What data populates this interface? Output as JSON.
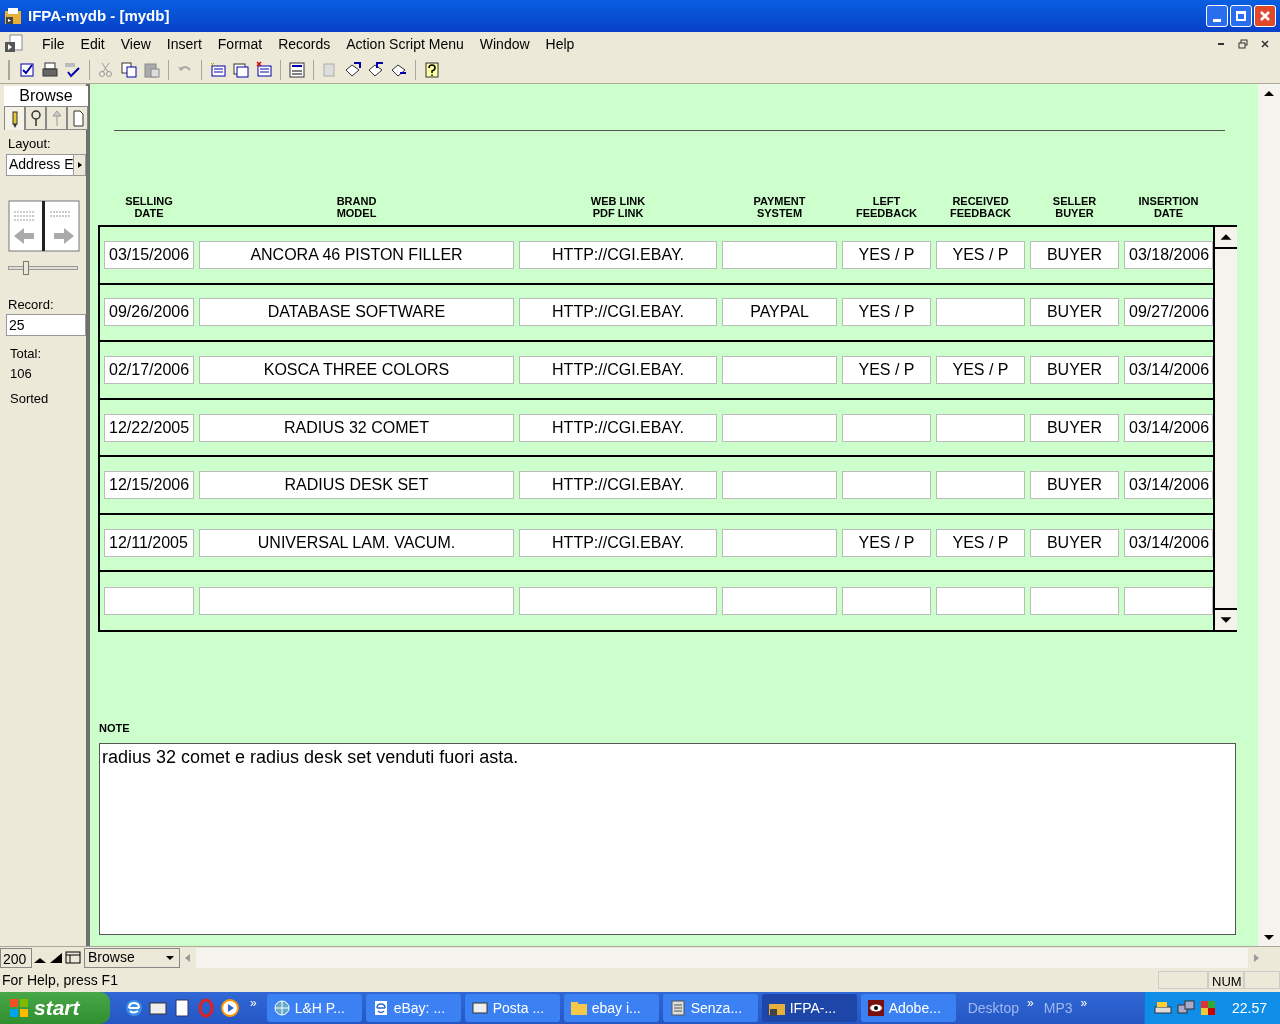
{
  "window": {
    "title": "IFPA-mydb - [mydb]"
  },
  "menu": [
    "File",
    "Edit",
    "View",
    "Insert",
    "Format",
    "Records",
    "Action Script Menu",
    "Window",
    "Help"
  ],
  "sidebar": {
    "mode": "Browse",
    "mode_buttons": [
      {
        "kind": "pencil",
        "selected": true
      },
      {
        "kind": "magnifier",
        "selected": false
      },
      {
        "kind": "pin",
        "selected": false
      },
      {
        "kind": "page",
        "selected": false
      }
    ],
    "layout_label": "Layout:",
    "layout_value": "Address E",
    "record_label": "Record:",
    "record_value": "25",
    "record_slider": {
      "level": 0.24
    },
    "total_label": "Total:",
    "total_value": "106",
    "sort_status": "Sorted"
  },
  "table": {
    "columns": [
      "SELLING\nDATE",
      "BRAND\nMODEL",
      "WEB LINK\nPDF LINK",
      "PAYMENT\nSYSTEM",
      "LEFT\nFEEDBACK",
      "RECEIVED\nFEEDBACK",
      "SELLER\nBUYER",
      "INSERTION\nDATE"
    ],
    "rows": [
      [
        "03/15/2006",
        "ANCORA 46 PISTON FILLER",
        "HTTP://CGI.EBAY.",
        null,
        "YES / P",
        "YES / P",
        "BUYER",
        "03/18/2006"
      ],
      [
        "09/26/2006",
        "DATABASE SOFTWARE",
        "HTTP://CGI.EBAY.",
        "PAYPAL",
        "YES / P",
        null,
        "BUYER",
        "09/27/2006"
      ],
      [
        "02/17/2006",
        "KOSCA THREE COLORS",
        "HTTP://CGI.EBAY.",
        null,
        "YES / P",
        "YES / P",
        "BUYER",
        "03/14/2006"
      ],
      [
        "12/22/2005",
        "RADIUS 32 COMET",
        "HTTP://CGI.EBAY.",
        null,
        null,
        null,
        "BUYER",
        "03/14/2006"
      ],
      [
        "12/15/2006",
        "RADIUS DESK SET",
        "HTTP://CGI.EBAY.",
        null,
        null,
        null,
        "BUYER",
        "03/14/2006"
      ],
      [
        "12/11/2005",
        "UNIVERSAL LAM. VACUM.",
        "HTTP://CGI.EBAY.",
        null,
        "YES / P",
        "YES / P",
        "BUYER",
        "03/14/2006"
      ]
    ]
  },
  "note": {
    "label": "NOTE",
    "value": "radius 32 comet e radius desk set venduti fuori asta."
  },
  "bottom_bar": {
    "zoom": "200",
    "mode": "Browse"
  },
  "status_bar": {
    "help": "For Help, press F1",
    "num": "NUM"
  },
  "taskbar": {
    "start": "start",
    "more": "»",
    "buttons": [
      {
        "label": "L&H P...",
        "selected": false
      },
      {
        "label": "eBay: ...",
        "selected": false
      },
      {
        "label": "Posta ...",
        "selected": false
      },
      {
        "label": "ebay i...",
        "selected": false
      },
      {
        "label": "Senza...",
        "selected": false
      },
      {
        "label": "IFPA-...",
        "selected": true
      },
      {
        "label": "Adobe...",
        "selected": false
      }
    ],
    "toolbars": [
      {
        "label": "Desktop",
        "more": "»"
      },
      {
        "label": "MP3",
        "more": "»"
      }
    ],
    "clock": "22.57"
  }
}
